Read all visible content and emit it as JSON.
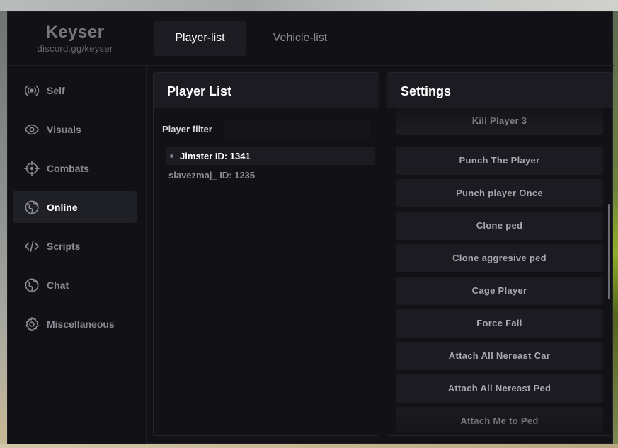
{
  "brand": {
    "name": "Keyser",
    "subtitle": "discord.gg/keyser"
  },
  "tabs": [
    {
      "label": "Player-list",
      "active": true
    },
    {
      "label": "Vehicle-list",
      "active": false
    }
  ],
  "sidebar": {
    "items": [
      {
        "label": "Self",
        "icon": "broadcast-icon",
        "active": false
      },
      {
        "label": "Visuals",
        "icon": "eye-icon",
        "active": false
      },
      {
        "label": "Combats",
        "icon": "crosshair-icon",
        "active": false
      },
      {
        "label": "Online",
        "icon": "globe-icon",
        "active": true
      },
      {
        "label": "Scripts",
        "icon": "code-icon",
        "active": false
      },
      {
        "label": "Chat",
        "icon": "globe-icon",
        "active": false
      },
      {
        "label": "Miscellaneous",
        "icon": "gear-icon",
        "active": false
      }
    ]
  },
  "player_panel": {
    "title": "Player List",
    "filter_label": "Player filter",
    "filter_value": "",
    "players": [
      {
        "name": "Jimster ID: 1341",
        "selected": true
      },
      {
        "name": "slavezmaj_ ID: 1235",
        "selected": false
      }
    ]
  },
  "settings_panel": {
    "title": "Settings",
    "buttons": [
      "Kill Player 3",
      "Punch The Player",
      "Punch player Once",
      "Clone ped",
      "Clone aggresive ped",
      "Cage Player",
      "Force Fall",
      "Attach All Nereast Car",
      "Attach All Nereast Ped",
      "Attach Me to Ped"
    ]
  },
  "colors": {
    "window_bg": "#111116",
    "panel_header_bg": "#1b1b21",
    "active_bg": "#202027",
    "text_active": "#ffffff",
    "text_muted": "#8a8a92"
  }
}
